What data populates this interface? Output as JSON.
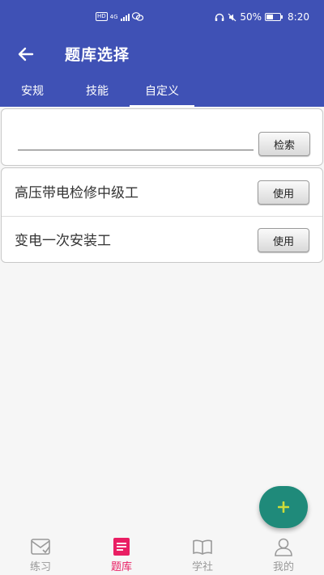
{
  "status_bar": {
    "left_badge": "HD",
    "network": "4G",
    "battery": "50%",
    "battery_level": 0.5,
    "time": "8:20"
  },
  "header": {
    "back_icon": "arrow-left-icon",
    "title": "题库选择"
  },
  "tabs": [
    {
      "label": "安规",
      "active": false
    },
    {
      "label": "技能",
      "active": false
    },
    {
      "label": "自定义",
      "active": true
    }
  ],
  "search": {
    "value": "",
    "placeholder": "",
    "button_label": "检索"
  },
  "bank_list": [
    {
      "name": "高压带电检修中级工",
      "button_label": "使用"
    },
    {
      "name": "变电一次安装工",
      "button_label": "使用"
    }
  ],
  "fab": {
    "icon": "plus-icon",
    "label": "+"
  },
  "bottom_nav": [
    {
      "label": "练习",
      "icon": "mail-icon",
      "active": false
    },
    {
      "label": "题库",
      "icon": "list-icon",
      "active": true
    },
    {
      "label": "学社",
      "icon": "book-icon",
      "active": false
    },
    {
      "label": "我的",
      "icon": "user-icon",
      "active": false
    }
  ],
  "colors": {
    "primary": "#3f51b5",
    "active_nav": "#e91e63",
    "inactive_nav": "#999999",
    "fab": "#1f8a7a",
    "fab_icon": "#cddc39"
  }
}
